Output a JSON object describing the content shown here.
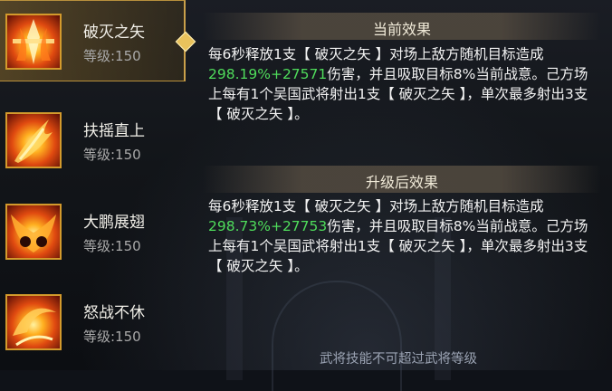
{
  "skills": [
    {
      "name": "破灭之矢",
      "level": "等级:150",
      "selected": true
    },
    {
      "name": "扶摇直上",
      "level": "等级:150",
      "selected": false
    },
    {
      "name": "大鹏展翅",
      "level": "等级:150",
      "selected": false
    },
    {
      "name": "怒战不休",
      "level": "等级:150",
      "selected": false
    }
  ],
  "current": {
    "header": "当前效果",
    "part1": "每6秒释放1支【 破灭之矢 】对场上敌方随机目标造成",
    "value": "298.19%+27571",
    "part2": "伤害，并且吸取目标8%当前战意。己方场上每有1个吴国武将射出1支【 破灭之矢 】，单次最多射出3支【 破灭之矢 】。"
  },
  "upgrade": {
    "header": "升级后效果",
    "part1": "每6秒释放1支【 破灭之矢 】对场上敌方随机目标造成",
    "value": "298.73%+27753",
    "part2": "伤害，并且吸取目标8%当前战意。己方场上每有1个吴国武将射出1支【 破灭之矢 】，单次最多射出3支【 破灭之矢 】。"
  },
  "footer_note": "武将技能不可超过武将等级",
  "colors": {
    "highlight": "#4fdc5b",
    "accent": "#caa04a"
  }
}
